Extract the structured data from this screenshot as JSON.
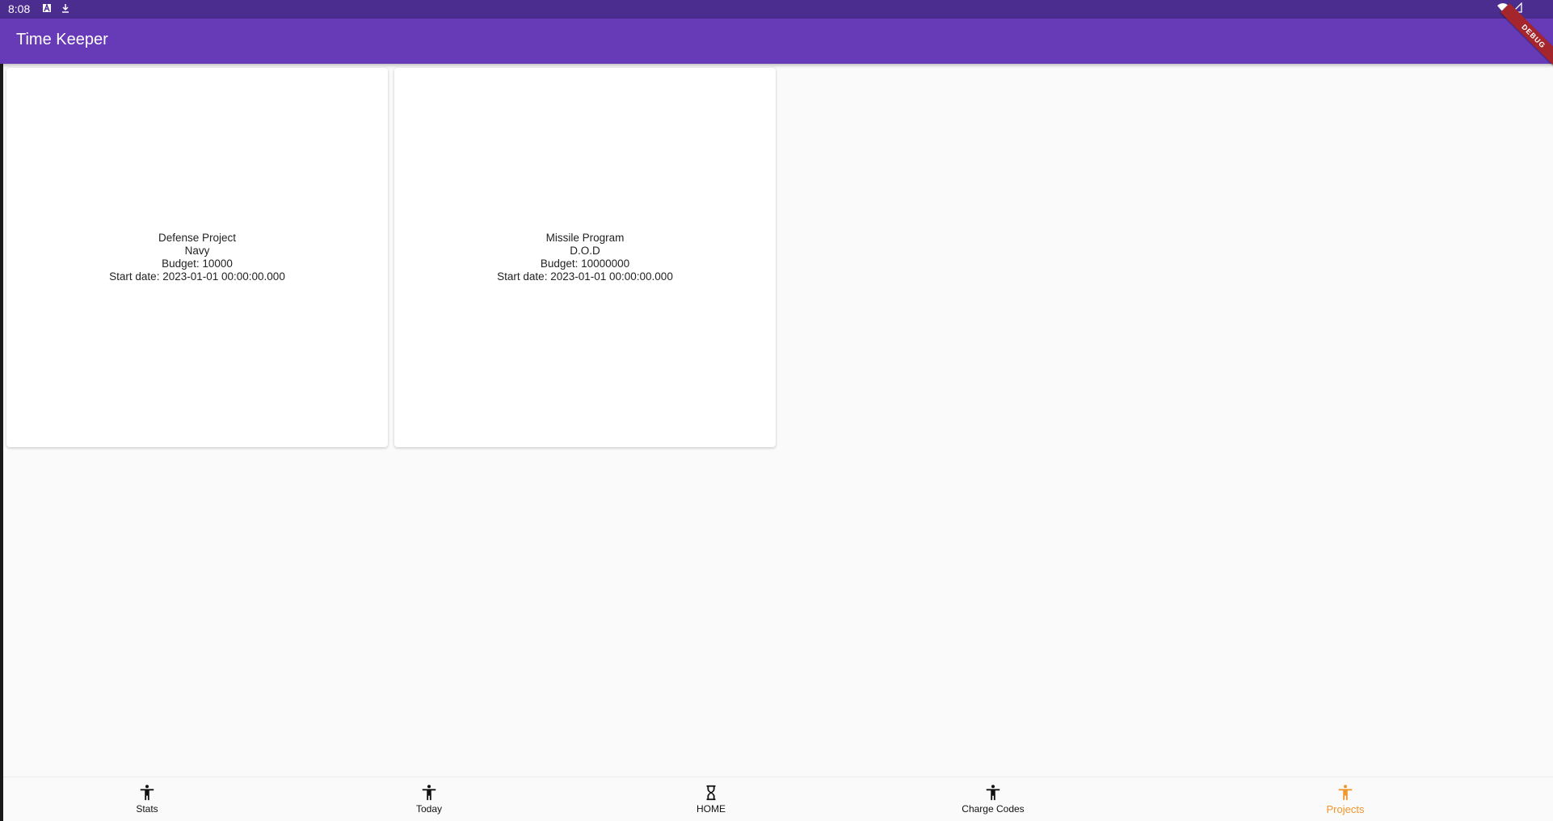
{
  "status_bar": {
    "time": "8:08",
    "left_icons": [
      "app-notification-icon",
      "download-icon"
    ],
    "right_icons": [
      "wifi-icon",
      "cell-signal-icon"
    ]
  },
  "app_bar": {
    "title": "Time Keeper",
    "debug_banner": "DEBUG",
    "color": "#673ab7"
  },
  "projects": [
    {
      "name": "Defense Project",
      "org": "Navy",
      "budget": "Budget: 10000",
      "start": "Start date: 2023-01-01 00:00:00.000"
    },
    {
      "name": "Missile Program",
      "org": "D.O.D",
      "budget": "Budget: 10000000",
      "start": "Start date: 2023-01-01 00:00:00.000"
    }
  ],
  "bottom_nav": {
    "items": [
      {
        "label": "Stats",
        "icon": "accessibility-icon"
      },
      {
        "label": "Today",
        "icon": "accessibility-icon"
      },
      {
        "label": "HOME",
        "icon": "hourglass-icon"
      },
      {
        "label": "Charge Codes",
        "icon": "accessibility-icon"
      },
      {
        "label": "Projects",
        "icon": "accessibility-icon"
      }
    ],
    "active": "Projects",
    "active_color": "#f0962b"
  }
}
